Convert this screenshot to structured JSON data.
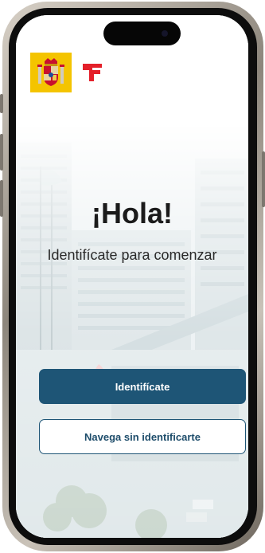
{
  "greeting": "¡Hola!",
  "subtitle": "Identifícate para comenzar",
  "buttons": {
    "primary_label": "Identifícate",
    "secondary_label": "Navega sin identificarte"
  },
  "colors": {
    "primary_button": "#1e5576",
    "coat_background": "#f4c400",
    "dgt_red": "#e4202a"
  },
  "icons": {
    "coat_of_arms": "spain-coat-of-arms-icon",
    "dgt_logo": "dgt-logo-icon"
  }
}
